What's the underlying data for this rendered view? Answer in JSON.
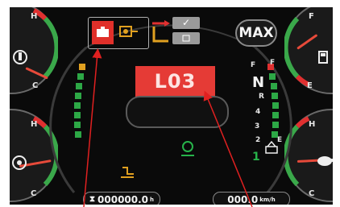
{
  "max_button": {
    "label": "MAX"
  },
  "error_code": "L03",
  "gears": {
    "top": "F",
    "current": "N",
    "r": "R",
    "g4": "4",
    "g3": "3",
    "g2": "2",
    "g1": "1"
  },
  "left_gauges": {
    "top": {
      "hi": "H",
      "lo": "C"
    },
    "bottom": {
      "hi": "H",
      "lo": "C"
    }
  },
  "right_gauges": {
    "top": {
      "hi": "F",
      "lo": "E"
    },
    "bottom": {
      "hi": "H",
      "lo": "C"
    }
  },
  "center_gauge_hi_lo": {
    "hi": "F",
    "lo": "E"
  },
  "hour_meter": {
    "value": "000000.0",
    "unit": "h"
  },
  "speed": {
    "value": "000.0",
    "unit": "km/h"
  },
  "colors": {
    "warning": "#e0302a",
    "code_bg": "#e53b36",
    "active_green": "#27b34a",
    "amber": "#e0a020"
  },
  "icons": [
    "engine-warning-icon",
    "transmission-icon",
    "check-icon",
    "list-icon",
    "coolant-temp-icon",
    "oil-temp-icon",
    "fuel-icon",
    "turtle-icon",
    "parking-icon",
    "attachment-icon",
    "hydraulic-icon"
  ]
}
